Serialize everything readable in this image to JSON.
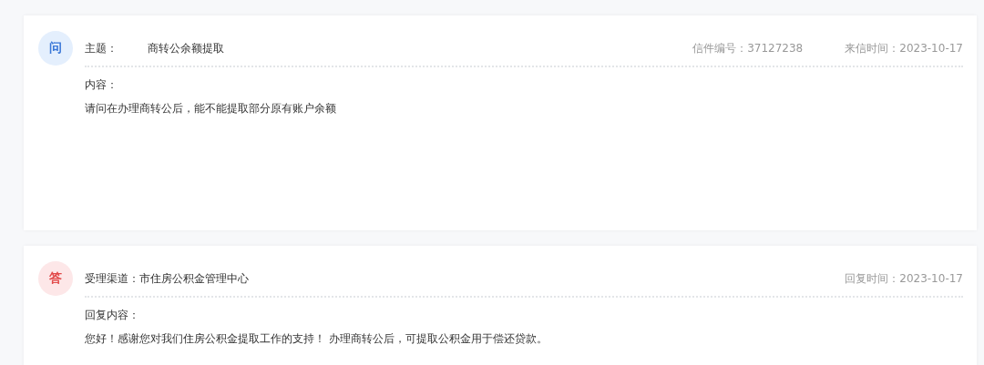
{
  "cards": [
    {
      "kind": "question",
      "badge": "问",
      "header": [
        "主题：",
        "商转公余额提取"
      ],
      "meta": [
        "信件编号：37127238",
        "来信时间：2023-10-17"
      ],
      "content_label": "内容：",
      "content": "请问在办理商转公后，能不能提取部分原有账户余额"
    },
    {
      "kind": "answer",
      "badge": "答",
      "header": [
        "受理渠道：市住房公积金管理中心"
      ],
      "meta": [
        "回复时间：2023-10-17"
      ],
      "content_label": "回复内容：",
      "content": "您好！感谢您对我们住房公积金提取工作的支持！ 办理商转公后，可提取公积金用于偿还贷款。"
    }
  ]
}
